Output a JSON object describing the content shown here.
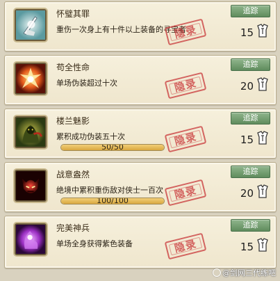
{
  "achievements": [
    {
      "title": "怀璧其罪",
      "description": "重伤一次身上有十件以上装备的寻宝者",
      "track_label": "追踪",
      "points": "15",
      "stamp": "隐录",
      "icon": "sword-man-icon",
      "progress": null
    },
    {
      "title": "苟全性命",
      "description": "单场伪装超过十次",
      "track_label": "追踪",
      "points": "20",
      "stamp": "隐录",
      "icon": "fire-burst-icon",
      "progress": null
    },
    {
      "title": "楼兰魅影",
      "description": "累积成功伪装五十次",
      "track_label": "追踪",
      "points": "15",
      "stamp": "隐录",
      "icon": "hooded-figure-icon",
      "progress": {
        "current": 50,
        "total": 50,
        "text": "50/50"
      }
    },
    {
      "title": "战意盎然",
      "description": "绝境中累积重伤敌对侠士一百次",
      "track_label": "追踪",
      "points": "20",
      "stamp": "隐录",
      "icon": "red-demon-face-icon",
      "progress": {
        "current": 100,
        "total": 100,
        "text": "100/100"
      }
    },
    {
      "title": "完美神兵",
      "description": "单场全身获得紫色装备",
      "track_label": "追踪",
      "points": "15",
      "stamp": "隐录",
      "icon": "purple-aura-icon",
      "progress": null
    }
  ],
  "watermark": "@剑网三代练吧",
  "colors": {
    "card_bg": "#f2ead3",
    "track_button": "#6e9a6b",
    "stamp": "#c9383a",
    "progress_fill": "#e2b556"
  }
}
